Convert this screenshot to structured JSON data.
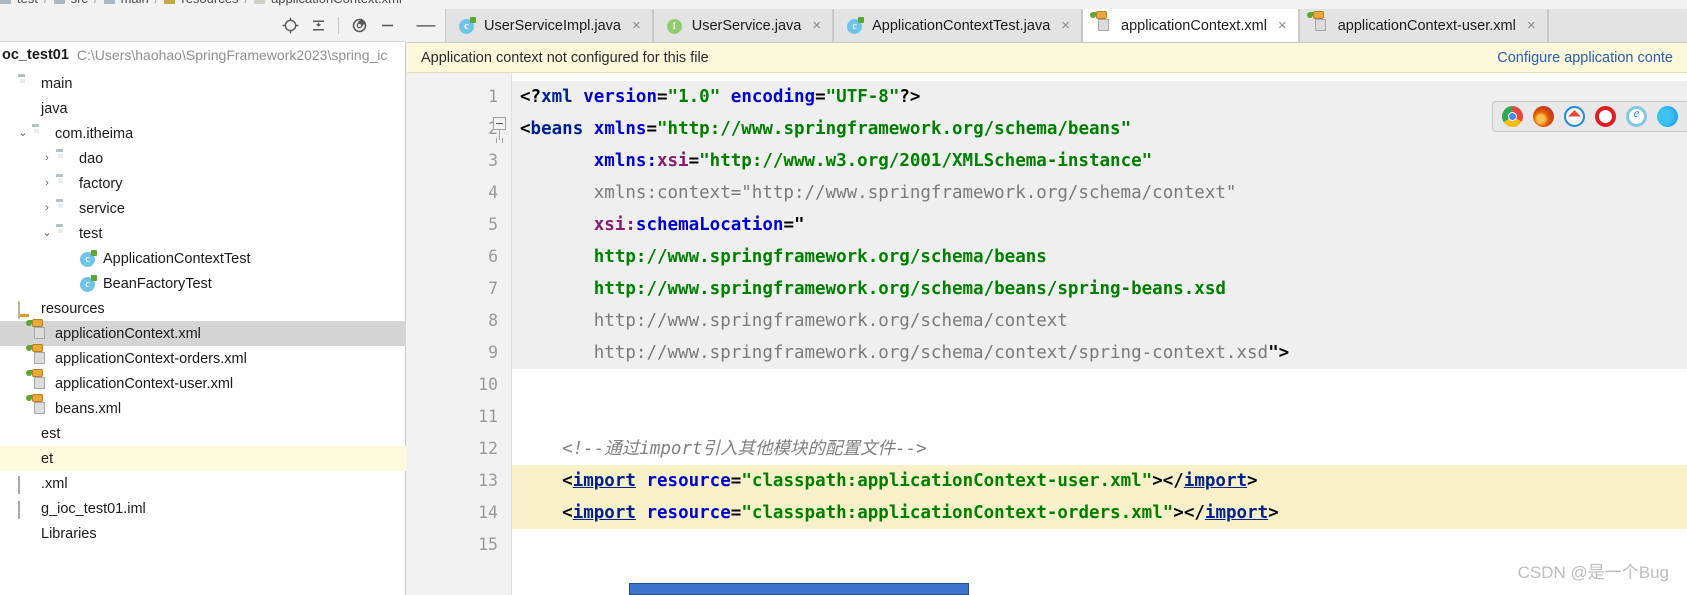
{
  "breadcrumb": {
    "items": [
      "test",
      "src",
      "main",
      "resources",
      "applicationContext.xml"
    ]
  },
  "left_panel": {
    "toolbar": {
      "locate_icon": "crosshair-target-icon",
      "collapse_icon": "collapse-all-icon",
      "settings_icon": "gear-icon",
      "hide_icon": "minimize-icon"
    },
    "project": {
      "name": "oc_test01",
      "path": "C:\\Users\\haohao\\SpringFramework2023\\spring_ic"
    },
    "tree": [
      {
        "label": "main",
        "icon": "folder-icon",
        "indent": 0,
        "arrow": "",
        "state": "normal"
      },
      {
        "label": "java",
        "icon": "source-root-icon",
        "indent": 0,
        "arrow": "",
        "state": "normal"
      },
      {
        "label": "com.itheima",
        "icon": "package-icon",
        "indent": 1,
        "arrow": "v",
        "state": "normal"
      },
      {
        "label": "dao",
        "icon": "package-icon",
        "indent": 2,
        "arrow": ">",
        "state": "normal"
      },
      {
        "label": "factory",
        "icon": "package-icon",
        "indent": 2,
        "arrow": ">",
        "state": "normal"
      },
      {
        "label": "service",
        "icon": "package-icon",
        "indent": 2,
        "arrow": ">",
        "state": "normal"
      },
      {
        "label": "test",
        "icon": "package-icon",
        "indent": 2,
        "arrow": "v",
        "state": "normal"
      },
      {
        "label": "ApplicationContextTest",
        "icon": "java-class-icon",
        "indent": 3,
        "arrow": "",
        "state": "normal"
      },
      {
        "label": "BeanFactoryTest",
        "icon": "java-class-icon",
        "indent": 3,
        "arrow": "",
        "state": "normal"
      },
      {
        "label": "resources",
        "icon": "resources-root-icon",
        "indent": 0,
        "arrow": "",
        "state": "normal"
      },
      {
        "label": "applicationContext.xml",
        "icon": "spring-xml-icon",
        "indent": 1,
        "arrow": "",
        "state": "selected"
      },
      {
        "label": "applicationContext-orders.xml",
        "icon": "spring-xml-icon",
        "indent": 1,
        "arrow": "",
        "state": "normal"
      },
      {
        "label": "applicationContext-user.xml",
        "icon": "spring-xml-icon",
        "indent": 1,
        "arrow": "",
        "state": "normal"
      },
      {
        "label": "beans.xml",
        "icon": "spring-xml-icon",
        "indent": 1,
        "arrow": "",
        "state": "normal"
      },
      {
        "label": "est",
        "icon": "test-root-icon",
        "indent": -1,
        "arrow": "",
        "state": "normal"
      },
      {
        "label": "et",
        "icon": "target-root-icon",
        "indent": -1,
        "arrow": "",
        "state": "highlighted"
      },
      {
        "label": ".xml",
        "icon": "xml-file-icon",
        "indent": -1,
        "arrow": "",
        "state": "normal"
      },
      {
        "label": "g_ioc_test01.iml",
        "icon": "iml-file-icon",
        "indent": -1,
        "arrow": "",
        "state": "normal"
      },
      {
        "label": "Libraries",
        "icon": "libraries-icon",
        "indent": -1,
        "arrow": "",
        "state": "normal"
      }
    ]
  },
  "editor": {
    "tabs": [
      {
        "label": "UserServiceImpl.java",
        "icon": "java-class-icon",
        "active": false,
        "closable": true
      },
      {
        "label": "UserService.java",
        "icon": "java-interface-icon",
        "active": false,
        "closable": true
      },
      {
        "label": "ApplicationContextTest.java",
        "icon": "java-class-icon",
        "active": false,
        "closable": true
      },
      {
        "label": "applicationContext.xml",
        "icon": "spring-xml-icon",
        "active": true,
        "closable": true
      },
      {
        "label": "applicationContext-user.xml",
        "icon": "spring-xml-icon",
        "active": false,
        "closable": true
      }
    ],
    "notification": {
      "message": "Application context not configured for this file",
      "link": "Configure application conte"
    },
    "browser_icons": [
      "chrome-icon",
      "firefox-icon",
      "safari-icon",
      "opera-icon",
      "ie-icon",
      "edge-icon"
    ],
    "line_numbers": [
      "1",
      "2",
      "3",
      "4",
      "5",
      "6",
      "7",
      "8",
      "9",
      "10",
      "11",
      "12",
      "13",
      "14",
      "15"
    ],
    "code_lines": [
      {
        "n": 1,
        "bg": "shade",
        "tokens": [
          {
            "t": "<?",
            "c": "tk-punct"
          },
          {
            "t": "xml",
            "c": "tk-tag"
          },
          {
            "t": " ",
            "c": "tk-plain"
          },
          {
            "t": "version",
            "c": "tk-attr"
          },
          {
            "t": "=",
            "c": "tk-punct"
          },
          {
            "t": "\"1.0\"",
            "c": "tk-str"
          },
          {
            "t": " ",
            "c": "tk-plain"
          },
          {
            "t": "encoding",
            "c": "tk-attr"
          },
          {
            "t": "=",
            "c": "tk-punct"
          },
          {
            "t": "\"UTF-8\"",
            "c": "tk-str"
          },
          {
            "t": "?>",
            "c": "tk-punct"
          }
        ]
      },
      {
        "n": 2,
        "bg": "shade",
        "tokens": [
          {
            "t": "<",
            "c": "tk-punct"
          },
          {
            "t": "beans",
            "c": "tk-tag"
          },
          {
            "t": " ",
            "c": "tk-plain"
          },
          {
            "t": "xmlns",
            "c": "tk-attr"
          },
          {
            "t": "=",
            "c": "tk-punct"
          },
          {
            "t": "\"http://www.springframework.org/schema/beans\"",
            "c": "tk-str"
          }
        ]
      },
      {
        "n": 3,
        "bg": "shade",
        "tokens": [
          {
            "t": "       ",
            "c": "tk-plain"
          },
          {
            "t": "xmlns:",
            "c": "tk-attr"
          },
          {
            "t": "xsi",
            "c": "tk-ns"
          },
          {
            "t": "=",
            "c": "tk-punct"
          },
          {
            "t": "\"http://www.w3.org/2001/XMLSchema-instance\"",
            "c": "tk-str"
          }
        ]
      },
      {
        "n": 4,
        "bg": "shade",
        "tokens": [
          {
            "t": "       ",
            "c": "tk-plain"
          },
          {
            "t": "xmlns:context=\"http://www.springframework.org/schema/context\"",
            "c": "tk-strdim"
          }
        ]
      },
      {
        "n": 5,
        "bg": "shade",
        "tokens": [
          {
            "t": "       ",
            "c": "tk-plain"
          },
          {
            "t": "xsi:",
            "c": "tk-ns"
          },
          {
            "t": "schemaLocation",
            "c": "tk-attr"
          },
          {
            "t": "=",
            "c": "tk-punct"
          },
          {
            "t": "\"",
            "c": "tk-quote"
          }
        ]
      },
      {
        "n": 6,
        "bg": "shade",
        "tokens": [
          {
            "t": "       ",
            "c": "tk-plain"
          },
          {
            "t": "http://www.springframework.org/schema/beans",
            "c": "tk-str"
          }
        ]
      },
      {
        "n": 7,
        "bg": "shade",
        "tokens": [
          {
            "t": "       ",
            "c": "tk-plain"
          },
          {
            "t": "http://www.springframework.org/schema/beans/spring-beans.xsd",
            "c": "tk-str"
          }
        ]
      },
      {
        "n": 8,
        "bg": "shade",
        "tokens": [
          {
            "t": "       ",
            "c": "tk-plain"
          },
          {
            "t": "http://www.springframework.org/schema/context",
            "c": "tk-strdim"
          }
        ]
      },
      {
        "n": 9,
        "bg": "shade",
        "tokens": [
          {
            "t": "       ",
            "c": "tk-plain"
          },
          {
            "t": "http://www.springframework.org/schema/context/spring-context.xsd",
            "c": "tk-strdim"
          },
          {
            "t": "\">",
            "c": "tk-punct"
          }
        ]
      },
      {
        "n": 10,
        "bg": "none",
        "tokens": []
      },
      {
        "n": 11,
        "bg": "none",
        "tokens": []
      },
      {
        "n": 12,
        "bg": "none",
        "tokens": [
          {
            "t": "    ",
            "c": "tk-plain"
          },
          {
            "t": "<!--通过import引入其他模块的配置文件-->",
            "c": "tk-comment"
          }
        ]
      },
      {
        "n": 13,
        "bg": "hl",
        "tokens": [
          {
            "t": "    ",
            "c": "tk-plain"
          },
          {
            "t": "<",
            "c": "tk-punct"
          },
          {
            "t": "import",
            "c": "tk-link"
          },
          {
            "t": " ",
            "c": "tk-plain"
          },
          {
            "t": "resource",
            "c": "tk-attr"
          },
          {
            "t": "=",
            "c": "tk-punct"
          },
          {
            "t": "\"classpath:applicationContext-user.xml\"",
            "c": "tk-str"
          },
          {
            "t": "></",
            "c": "tk-punct"
          },
          {
            "t": "import",
            "c": "tk-link"
          },
          {
            "t": ">",
            "c": "tk-punct"
          }
        ]
      },
      {
        "n": 14,
        "bg": "hl",
        "tokens": [
          {
            "t": "    ",
            "c": "tk-plain"
          },
          {
            "t": "<",
            "c": "tk-punct"
          },
          {
            "t": "import",
            "c": "tk-link"
          },
          {
            "t": " ",
            "c": "tk-plain"
          },
          {
            "t": "resource",
            "c": "tk-attr"
          },
          {
            "t": "=",
            "c": "tk-punct"
          },
          {
            "t": "\"classpath:applicationContext-orders.xml\"",
            "c": "tk-str"
          },
          {
            "t": "></",
            "c": "tk-punct"
          },
          {
            "t": "import",
            "c": "tk-link"
          },
          {
            "t": ">",
            "c": "tk-punct"
          }
        ]
      },
      {
        "n": 15,
        "bg": "none",
        "tokens": []
      }
    ]
  },
  "watermark": "CSDN @是一个Bug",
  "colors": {
    "selected_row": "#d4d4d4",
    "highlight_row": "#fdfade",
    "notification_bg": "#fbf8dc",
    "link": "#2a5db0",
    "code_highlight": "#f7f0c8",
    "string_green": "#008000",
    "tag_blue": "#00208f"
  }
}
